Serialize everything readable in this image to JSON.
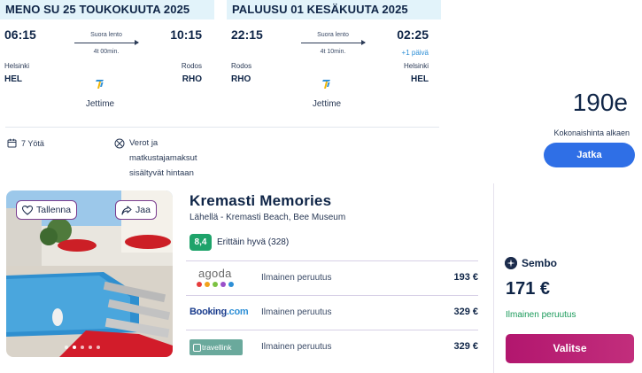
{
  "outbound": {
    "header": "MENO SU 25 TOUKOKUUTA 2025",
    "dep_time": "06:15",
    "arr_time": "10:15",
    "route_type": "Suora lento",
    "duration": "4t 00min.",
    "dep_city": "Helsinki",
    "dep_code": "HEL",
    "arr_city": "Rodos",
    "arr_code": "RHO",
    "airline": "Jettime"
  },
  "return": {
    "header": "PALUUSU 01 KESÄKUUTA 2025",
    "dep_time": "22:15",
    "arr_time": "02:25",
    "route_type": "Suora lento",
    "duration": "4t 10min.",
    "plus_day": "+1 päivä",
    "dep_city": "Rodos",
    "dep_code": "RHO",
    "arr_city": "Helsinki",
    "arr_code": "HEL",
    "airline": "Jettime"
  },
  "package": {
    "nights": "7 Yötä",
    "taxes_note": "Verot ja matkustajamaksut sisältyvät hintaan",
    "price": "190e",
    "price_label": "Kokonaishinta alkaen",
    "continue_label": "Jatka"
  },
  "hotel": {
    "save_label": "Tallenna",
    "share_label": "Jaa",
    "name": "Kremasti Memories",
    "nearby": "Lähellä - Kremasti Beach, Bee Museum",
    "rating_score": "8,4",
    "rating_text": "Erittäin hyvä (328)",
    "photo_count": 5,
    "photo_active_index": 1
  },
  "offers": [
    {
      "provider": "agoda",
      "cancel": "Ilmainen peruutus",
      "price": "193 €"
    },
    {
      "provider": "Booking",
      "provider_suffix": ".com",
      "cancel": "Ilmainen peruutus",
      "price": "329 €"
    },
    {
      "provider": "travellink",
      "cancel": "Ilmainen peruutus",
      "price": "329 €"
    }
  ],
  "featured": {
    "provider": "Sembo",
    "price": "171 €",
    "cancel": "Ilmainen peruutus",
    "select_label": "Valitse"
  },
  "colors": {
    "header_bg": "#e2f3fa",
    "primary_blue": "#2f6fe6",
    "rating_green": "#1ea36a",
    "select_magenta": "#b2166e",
    "free_cancel_green": "#1a9a5a"
  }
}
